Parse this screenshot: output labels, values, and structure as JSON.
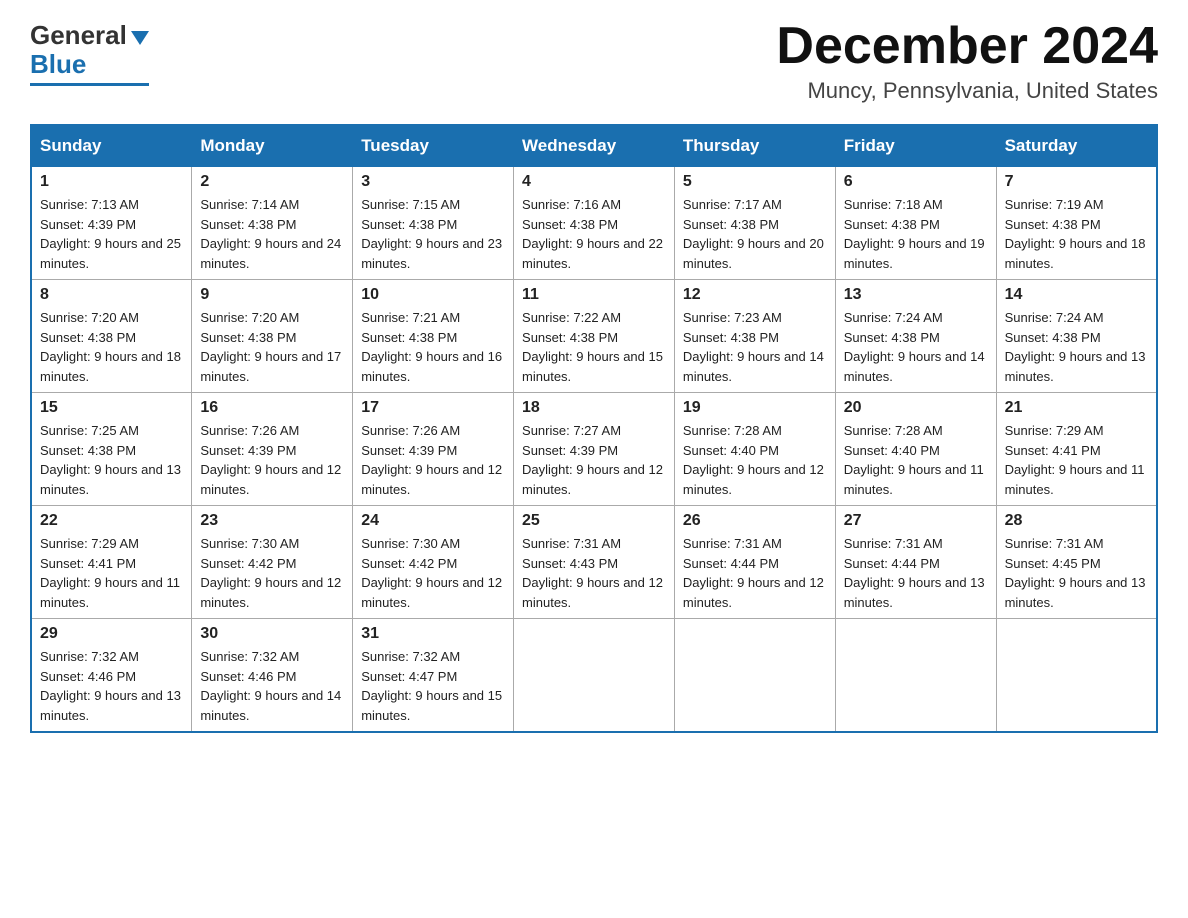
{
  "header": {
    "logo_line1": "General",
    "logo_line2": "Blue",
    "month_title": "December 2024",
    "location": "Muncy, Pennsylvania, United States"
  },
  "weekdays": [
    "Sunday",
    "Monday",
    "Tuesday",
    "Wednesday",
    "Thursday",
    "Friday",
    "Saturday"
  ],
  "weeks": [
    [
      {
        "day": "1",
        "sunrise": "Sunrise: 7:13 AM",
        "sunset": "Sunset: 4:39 PM",
        "daylight": "Daylight: 9 hours and 25 minutes."
      },
      {
        "day": "2",
        "sunrise": "Sunrise: 7:14 AM",
        "sunset": "Sunset: 4:38 PM",
        "daylight": "Daylight: 9 hours and 24 minutes."
      },
      {
        "day": "3",
        "sunrise": "Sunrise: 7:15 AM",
        "sunset": "Sunset: 4:38 PM",
        "daylight": "Daylight: 9 hours and 23 minutes."
      },
      {
        "day": "4",
        "sunrise": "Sunrise: 7:16 AM",
        "sunset": "Sunset: 4:38 PM",
        "daylight": "Daylight: 9 hours and 22 minutes."
      },
      {
        "day": "5",
        "sunrise": "Sunrise: 7:17 AM",
        "sunset": "Sunset: 4:38 PM",
        "daylight": "Daylight: 9 hours and 20 minutes."
      },
      {
        "day": "6",
        "sunrise": "Sunrise: 7:18 AM",
        "sunset": "Sunset: 4:38 PM",
        "daylight": "Daylight: 9 hours and 19 minutes."
      },
      {
        "day": "7",
        "sunrise": "Sunrise: 7:19 AM",
        "sunset": "Sunset: 4:38 PM",
        "daylight": "Daylight: 9 hours and 18 minutes."
      }
    ],
    [
      {
        "day": "8",
        "sunrise": "Sunrise: 7:20 AM",
        "sunset": "Sunset: 4:38 PM",
        "daylight": "Daylight: 9 hours and 18 minutes."
      },
      {
        "day": "9",
        "sunrise": "Sunrise: 7:20 AM",
        "sunset": "Sunset: 4:38 PM",
        "daylight": "Daylight: 9 hours and 17 minutes."
      },
      {
        "day": "10",
        "sunrise": "Sunrise: 7:21 AM",
        "sunset": "Sunset: 4:38 PM",
        "daylight": "Daylight: 9 hours and 16 minutes."
      },
      {
        "day": "11",
        "sunrise": "Sunrise: 7:22 AM",
        "sunset": "Sunset: 4:38 PM",
        "daylight": "Daylight: 9 hours and 15 minutes."
      },
      {
        "day": "12",
        "sunrise": "Sunrise: 7:23 AM",
        "sunset": "Sunset: 4:38 PM",
        "daylight": "Daylight: 9 hours and 14 minutes."
      },
      {
        "day": "13",
        "sunrise": "Sunrise: 7:24 AM",
        "sunset": "Sunset: 4:38 PM",
        "daylight": "Daylight: 9 hours and 14 minutes."
      },
      {
        "day": "14",
        "sunrise": "Sunrise: 7:24 AM",
        "sunset": "Sunset: 4:38 PM",
        "daylight": "Daylight: 9 hours and 13 minutes."
      }
    ],
    [
      {
        "day": "15",
        "sunrise": "Sunrise: 7:25 AM",
        "sunset": "Sunset: 4:38 PM",
        "daylight": "Daylight: 9 hours and 13 minutes."
      },
      {
        "day": "16",
        "sunrise": "Sunrise: 7:26 AM",
        "sunset": "Sunset: 4:39 PM",
        "daylight": "Daylight: 9 hours and 12 minutes."
      },
      {
        "day": "17",
        "sunrise": "Sunrise: 7:26 AM",
        "sunset": "Sunset: 4:39 PM",
        "daylight": "Daylight: 9 hours and 12 minutes."
      },
      {
        "day": "18",
        "sunrise": "Sunrise: 7:27 AM",
        "sunset": "Sunset: 4:39 PM",
        "daylight": "Daylight: 9 hours and 12 minutes."
      },
      {
        "day": "19",
        "sunrise": "Sunrise: 7:28 AM",
        "sunset": "Sunset: 4:40 PM",
        "daylight": "Daylight: 9 hours and 12 minutes."
      },
      {
        "day": "20",
        "sunrise": "Sunrise: 7:28 AM",
        "sunset": "Sunset: 4:40 PM",
        "daylight": "Daylight: 9 hours and 11 minutes."
      },
      {
        "day": "21",
        "sunrise": "Sunrise: 7:29 AM",
        "sunset": "Sunset: 4:41 PM",
        "daylight": "Daylight: 9 hours and 11 minutes."
      }
    ],
    [
      {
        "day": "22",
        "sunrise": "Sunrise: 7:29 AM",
        "sunset": "Sunset: 4:41 PM",
        "daylight": "Daylight: 9 hours and 11 minutes."
      },
      {
        "day": "23",
        "sunrise": "Sunrise: 7:30 AM",
        "sunset": "Sunset: 4:42 PM",
        "daylight": "Daylight: 9 hours and 12 minutes."
      },
      {
        "day": "24",
        "sunrise": "Sunrise: 7:30 AM",
        "sunset": "Sunset: 4:42 PM",
        "daylight": "Daylight: 9 hours and 12 minutes."
      },
      {
        "day": "25",
        "sunrise": "Sunrise: 7:31 AM",
        "sunset": "Sunset: 4:43 PM",
        "daylight": "Daylight: 9 hours and 12 minutes."
      },
      {
        "day": "26",
        "sunrise": "Sunrise: 7:31 AM",
        "sunset": "Sunset: 4:44 PM",
        "daylight": "Daylight: 9 hours and 12 minutes."
      },
      {
        "day": "27",
        "sunrise": "Sunrise: 7:31 AM",
        "sunset": "Sunset: 4:44 PM",
        "daylight": "Daylight: 9 hours and 13 minutes."
      },
      {
        "day": "28",
        "sunrise": "Sunrise: 7:31 AM",
        "sunset": "Sunset: 4:45 PM",
        "daylight": "Daylight: 9 hours and 13 minutes."
      }
    ],
    [
      {
        "day": "29",
        "sunrise": "Sunrise: 7:32 AM",
        "sunset": "Sunset: 4:46 PM",
        "daylight": "Daylight: 9 hours and 13 minutes."
      },
      {
        "day": "30",
        "sunrise": "Sunrise: 7:32 AM",
        "sunset": "Sunset: 4:46 PM",
        "daylight": "Daylight: 9 hours and 14 minutes."
      },
      {
        "day": "31",
        "sunrise": "Sunrise: 7:32 AM",
        "sunset": "Sunset: 4:47 PM",
        "daylight": "Daylight: 9 hours and 15 minutes."
      },
      null,
      null,
      null,
      null
    ]
  ]
}
